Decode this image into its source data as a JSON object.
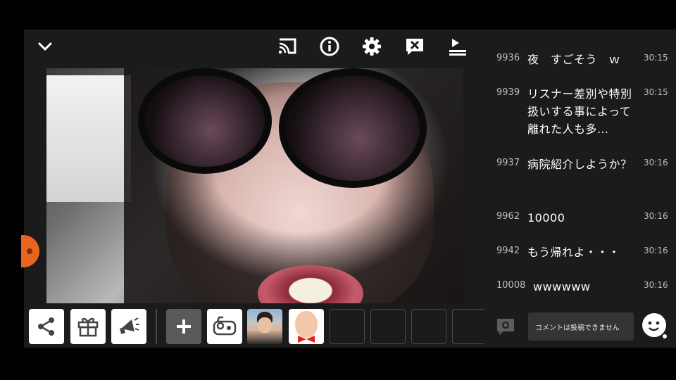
{
  "toolbar": {
    "icons": [
      "chevron-down-icon",
      "cast-icon",
      "info-icon",
      "settings-icon",
      "close-comment-icon",
      "download-icon"
    ]
  },
  "bottom_bar": {
    "icons": [
      "share-icon",
      "gift-icon",
      "megaphone-icon",
      "plus-icon",
      "game-icon"
    ]
  },
  "comments": [
    {
      "no": "9936",
      "text": "夜　すごそう　ｗ",
      "time": "30:15"
    },
    {
      "no": "9939",
      "text": "リスナー差別や特別扱いする事によって離れた人も多…",
      "time": "30:15"
    },
    {
      "no": "9937",
      "text": "病院紹介しようか？",
      "time": "30:16"
    },
    {
      "no": "9962",
      "text": "10000",
      "time": "30:16"
    },
    {
      "no": "9942",
      "text": "もう帰れよ・・・",
      "time": "30:16"
    },
    {
      "no": "10008",
      "text": "wwwwww",
      "time": "30:16"
    }
  ],
  "comment_input": {
    "placeholder": "コメントは投稿できません"
  },
  "colors": {
    "background": "#1b1b1b",
    "accent": "#e8651f",
    "comment_time": "#bdbdbd"
  }
}
